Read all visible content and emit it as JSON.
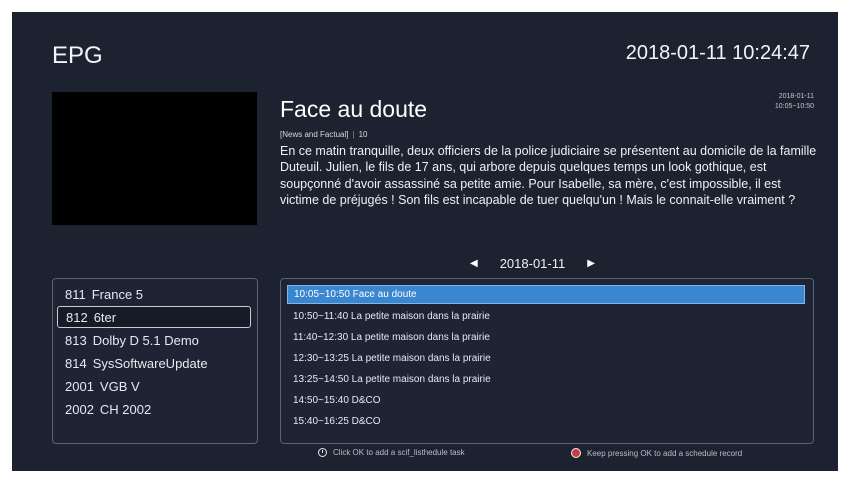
{
  "header": {
    "title": "EPG",
    "datetime": "2018-01-11 10:24:47"
  },
  "program": {
    "title": "Face au doute",
    "category": "[News and Factual]",
    "rating": "10",
    "date": "2018-01-11",
    "time": "10:05~10:50",
    "description": "En ce matin tranquille, deux officiers de la police judiciaire se présentent au domicile de la famille Duteuil. Julien, le fils de 17 ans, qui arbore depuis quelques temps un look gothique, est soupçonné d'avoir assassiné sa petite amie. Pour Isabelle, sa mère, c'est impossible, il est victime de préjugés ! Son fils est incapable de tuer quelqu'un ! Mais le connait-elle vraiment ?"
  },
  "date_nav": {
    "date": "2018-01-11"
  },
  "channels": [
    {
      "num": "811",
      "name": "France 5"
    },
    {
      "num": "812",
      "name": "6ter",
      "selected": true
    },
    {
      "num": "813",
      "name": "Dolby D 5.1 Demo"
    },
    {
      "num": "814",
      "name": "SysSoftwareUpdate"
    },
    {
      "num": "2001",
      "name": "VGB V"
    },
    {
      "num": "2002",
      "name": "CH 2002"
    }
  ],
  "schedule": [
    {
      "text": "10:05~10:50 Face au doute",
      "selected": true
    },
    {
      "text": "10:50~11:40 La petite maison dans la prairie"
    },
    {
      "text": "11:40~12:30 La petite maison dans la prairie"
    },
    {
      "text": "12:30~13:25 La petite maison dans la prairie"
    },
    {
      "text": "13:25~14:50 La petite maison dans la prairie"
    },
    {
      "text": "14:50~15:40 D&CO"
    },
    {
      "text": "15:40~16:25 D&CO"
    }
  ],
  "hints": {
    "ok": "Click OK to add a scif_listhedule task",
    "record": "Keep pressing OK to add a schedule record"
  },
  "icons": {
    "hint_ok": "clock-icon",
    "hint_record": "record-icon",
    "prev": "left-arrow-icon",
    "next": "right-arrow-icon"
  },
  "colors": {
    "background": "#1c2230",
    "selection": "#3a86cf",
    "record": "#d23b3b"
  }
}
